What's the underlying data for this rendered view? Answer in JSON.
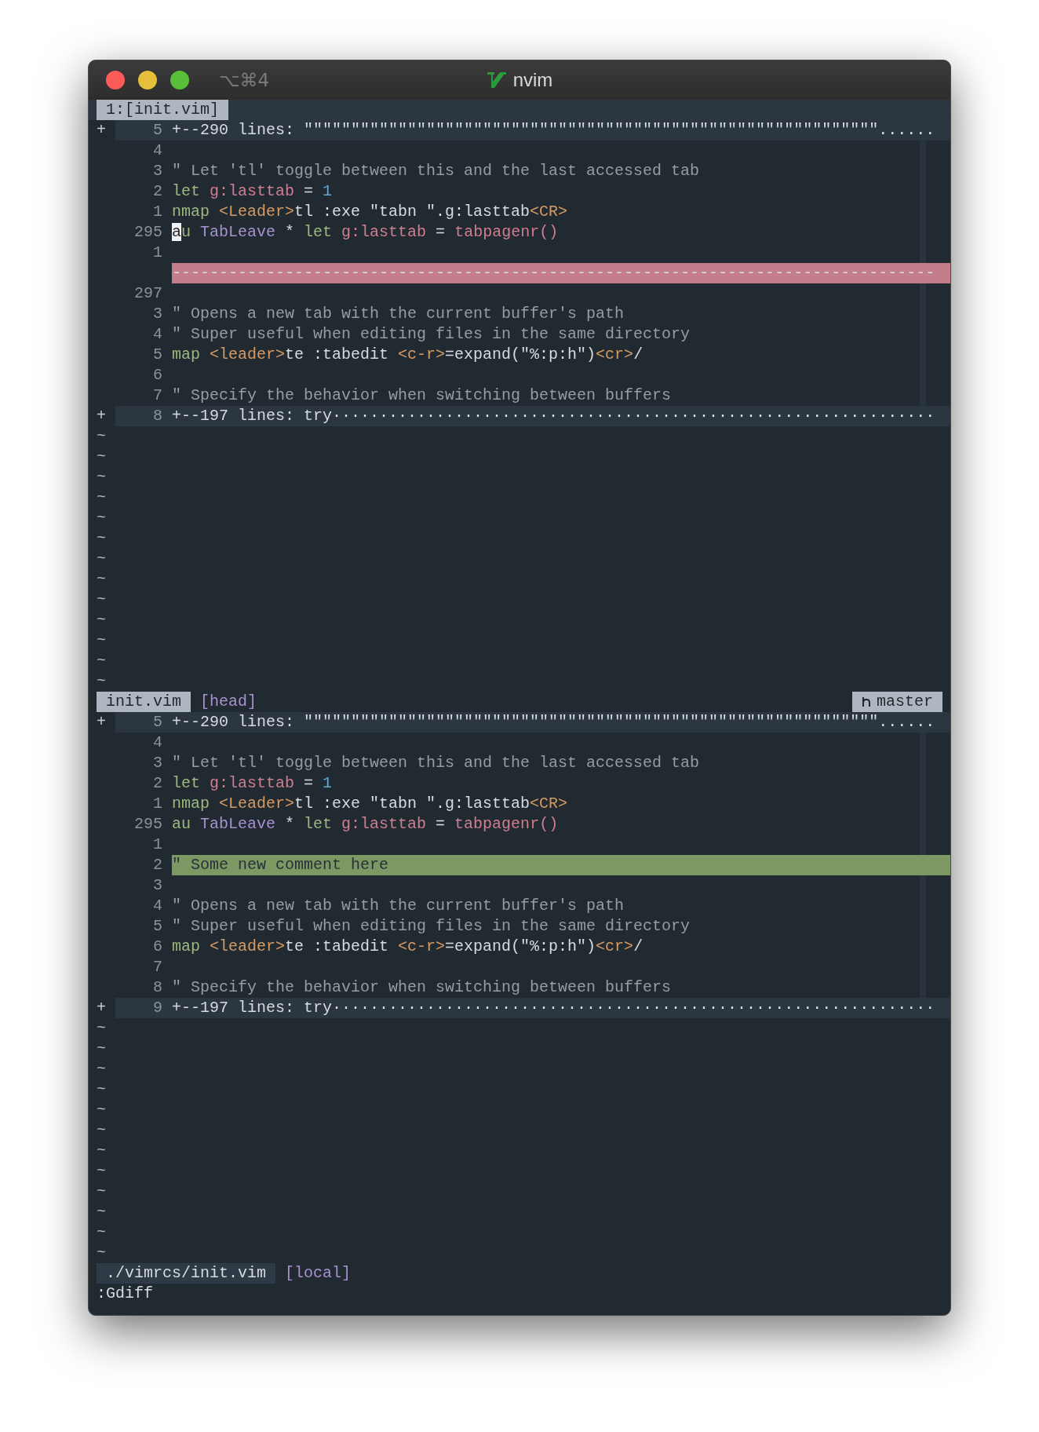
{
  "window": {
    "shortcut": "⌥⌘4",
    "title": "nvim"
  },
  "tabline": {
    "tabs": [
      {
        "label": "1:[init.vim]",
        "selected": true
      }
    ]
  },
  "panes": [
    {
      "lines": [
        {
          "kind": "fold",
          "sign": "+",
          "number": "5",
          "segments": [
            {
              "text": "+--290 lines: \"\"\"\"\"\"\"\"\"\"\"\"\"\"\"\"\"\"\"\"\"\"\"\"\"\"\"\"\"\"\"\"\"\"\"\"\"\"\"\"\"\"\"\"\"\"\"\"\"\"\"\"\"\"\"\"\"\"\"\"\"......",
              "kind": "plain"
            }
          ]
        },
        {
          "kind": "line",
          "number": "4"
        },
        {
          "kind": "line",
          "number": "3",
          "segments": [
            {
              "text": "\" Let 'tl' toggle between this and the last accessed tab",
              "kind": "comment"
            }
          ]
        },
        {
          "kind": "line",
          "number": "2",
          "segments": [
            {
              "text": "let ",
              "kind": "keyword"
            },
            {
              "text": "g:lasttab",
              "kind": "variable"
            },
            {
              "text": " = ",
              "kind": "plain"
            },
            {
              "text": "1",
              "kind": "number"
            }
          ]
        },
        {
          "kind": "line",
          "number": "1",
          "segments": [
            {
              "text": "nmap ",
              "kind": "keyword"
            },
            {
              "text": "<Leader>",
              "kind": "special"
            },
            {
              "text": "tl :exe \"tabn \".g:lasttab",
              "kind": "plain"
            },
            {
              "text": "<CR>",
              "kind": "special"
            }
          ]
        },
        {
          "kind": "line",
          "number": "295",
          "cursor": true,
          "segments": [
            {
              "text": "au ",
              "kind": "keyword"
            },
            {
              "text": "TabLeave",
              "kind": "type"
            },
            {
              "text": " * ",
              "kind": "plain"
            },
            {
              "text": "let ",
              "kind": "keyword"
            },
            {
              "text": "g:lasttab",
              "kind": "variable"
            },
            {
              "text": " = ",
              "kind": "plain"
            },
            {
              "text": "tabpagenr()",
              "kind": "variable"
            }
          ]
        },
        {
          "kind": "line",
          "number": "1"
        },
        {
          "kind": "delete",
          "segments": [
            {
              "text": "---------------------------------------------------------------------------------",
              "kind": "plain"
            }
          ]
        },
        {
          "kind": "line",
          "number": "297"
        },
        {
          "kind": "line",
          "number": "3",
          "segments": [
            {
              "text": "\" Opens a new tab with the current buffer's path",
              "kind": "comment"
            }
          ]
        },
        {
          "kind": "line",
          "number": "4",
          "segments": [
            {
              "text": "\" Super useful when editing files in the same directory",
              "kind": "comment"
            }
          ]
        },
        {
          "kind": "line",
          "number": "5",
          "segments": [
            {
              "text": "map ",
              "kind": "keyword"
            },
            {
              "text": "<leader>",
              "kind": "special"
            },
            {
              "text": "te :tabedit ",
              "kind": "plain"
            },
            {
              "text": "<c-r>",
              "kind": "special"
            },
            {
              "text": "=expand(\"%:p:h\")",
              "kind": "plain"
            },
            {
              "text": "<cr>",
              "kind": "special"
            },
            {
              "text": "/",
              "kind": "plain"
            }
          ]
        },
        {
          "kind": "line",
          "number": "6"
        },
        {
          "kind": "line",
          "number": "7",
          "segments": [
            {
              "text": "\" Specify the behavior when switching between buffers",
              "kind": "comment"
            }
          ]
        },
        {
          "kind": "fold",
          "sign": "+",
          "number": "8",
          "segments": [
            {
              "text": "+--197 lines: try································································",
              "kind": "plain"
            }
          ]
        }
      ],
      "tildes": [
        "~",
        "~",
        "~",
        "~",
        "~",
        "~",
        "~",
        "~",
        "~",
        "~",
        "~",
        "~",
        "~"
      ],
      "status": {
        "file": "init.vim",
        "active": true,
        "tag": "[head]",
        "branch": "master"
      }
    },
    {
      "lines": [
        {
          "kind": "fold",
          "sign": "+",
          "number": "5",
          "segments": [
            {
              "text": "+--290 lines: \"\"\"\"\"\"\"\"\"\"\"\"\"\"\"\"\"\"\"\"\"\"\"\"\"\"\"\"\"\"\"\"\"\"\"\"\"\"\"\"\"\"\"\"\"\"\"\"\"\"\"\"\"\"\"\"\"\"\"\"\"......",
              "kind": "plain"
            }
          ]
        },
        {
          "kind": "line",
          "number": "4"
        },
        {
          "kind": "line",
          "number": "3",
          "segments": [
            {
              "text": "\" Let 'tl' toggle between this and the last accessed tab",
              "kind": "comment"
            }
          ]
        },
        {
          "kind": "line",
          "number": "2",
          "segments": [
            {
              "text": "let ",
              "kind": "keyword"
            },
            {
              "text": "g:lasttab",
              "kind": "variable"
            },
            {
              "text": " = ",
              "kind": "plain"
            },
            {
              "text": "1",
              "kind": "number"
            }
          ]
        },
        {
          "kind": "line",
          "number": "1",
          "segments": [
            {
              "text": "nmap ",
              "kind": "keyword"
            },
            {
              "text": "<Leader>",
              "kind": "special"
            },
            {
              "text": "tl :exe \"tabn \".g:lasttab",
              "kind": "plain"
            },
            {
              "text": "<CR>",
              "kind": "special"
            }
          ]
        },
        {
          "kind": "line",
          "number": "295",
          "segments": [
            {
              "text": "au ",
              "kind": "keyword"
            },
            {
              "text": "TabLeave",
              "kind": "type"
            },
            {
              "text": " * ",
              "kind": "plain"
            },
            {
              "text": "let ",
              "kind": "keyword"
            },
            {
              "text": "g:lasttab",
              "kind": "variable"
            },
            {
              "text": " = ",
              "kind": "plain"
            },
            {
              "text": "tabpagenr()",
              "kind": "variable"
            }
          ]
        },
        {
          "kind": "line",
          "number": "1"
        },
        {
          "kind": "add",
          "number": "2",
          "segments": [
            {
              "text": "\" Some new comment here"
            }
          ]
        },
        {
          "kind": "line",
          "number": "3"
        },
        {
          "kind": "line",
          "number": "4",
          "segments": [
            {
              "text": "\" Opens a new tab with the current buffer's path",
              "kind": "comment"
            }
          ]
        },
        {
          "kind": "line",
          "number": "5",
          "segments": [
            {
              "text": "\" Super useful when editing files in the same directory",
              "kind": "comment"
            }
          ]
        },
        {
          "kind": "line",
          "number": "6",
          "segments": [
            {
              "text": "map ",
              "kind": "keyword"
            },
            {
              "text": "<leader>",
              "kind": "special"
            },
            {
              "text": "te :tabedit ",
              "kind": "plain"
            },
            {
              "text": "<c-r>",
              "kind": "special"
            },
            {
              "text": "=expand(\"%:p:h\")",
              "kind": "plain"
            },
            {
              "text": "<cr>",
              "kind": "special"
            },
            {
              "text": "/",
              "kind": "plain"
            }
          ]
        },
        {
          "kind": "line",
          "number": "7"
        },
        {
          "kind": "line",
          "number": "8",
          "segments": [
            {
              "text": "\" Specify the behavior when switching between buffers",
              "kind": "comment"
            }
          ]
        },
        {
          "kind": "fold",
          "sign": "+",
          "number": "9",
          "segments": [
            {
              "text": "+--197 lines: try································································",
              "kind": "plain"
            }
          ]
        }
      ],
      "tildes": [
        "~",
        "~",
        "~",
        "~",
        "~",
        "~",
        "~",
        "~",
        "~",
        "~",
        "~",
        "~"
      ],
      "status": {
        "file": "./vimrcs/init.vim",
        "active": false,
        "tag": "[local]"
      }
    }
  ],
  "command_line": ":Gdiff"
}
